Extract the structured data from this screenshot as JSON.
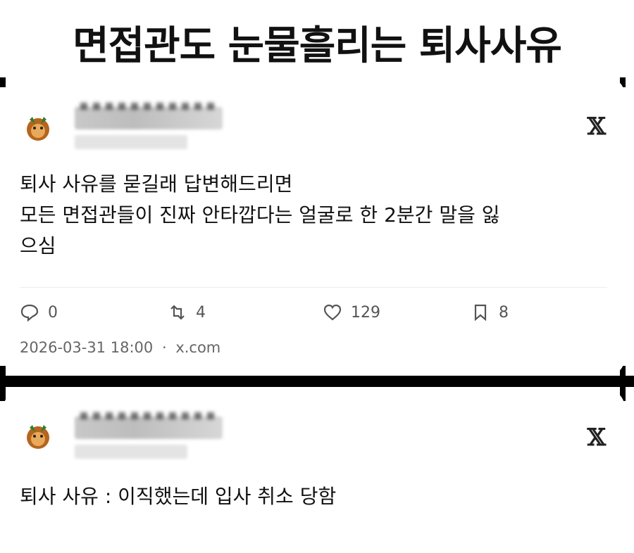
{
  "headline": "면접관도 눈물흘리는 퇴사사유",
  "posts": [
    {
      "text_lines": [
        "퇴사 사유를 묻길래 답변해드리면",
        "모든 면접관들이 진짜 안타깝다는 얼굴로 한 2분간 말을 잃",
        "으심"
      ],
      "brand_icon": "x-logo-icon",
      "x_logo": "𝕏",
      "stats": {
        "replies": "0",
        "reposts": "4",
        "likes": "129",
        "bookmarks": "8"
      },
      "timestamp": "2026-03-31 18:00",
      "separator": "·",
      "source": "x.com"
    },
    {
      "text_lines": [
        "퇴사 사유 : 이직했는데 입사 취소 당함"
      ],
      "brand_icon": "x-logo-icon",
      "x_logo": "𝕏"
    }
  ],
  "colors": {
    "background": "#ffffff",
    "divider": "#000000",
    "text": "#111111",
    "muted": "#666666"
  }
}
